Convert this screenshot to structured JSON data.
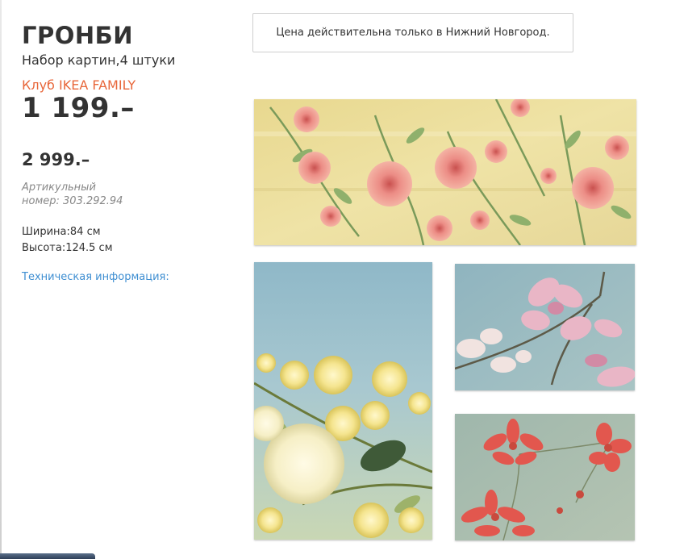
{
  "product": {
    "name": "ГРОНБИ",
    "description": "Набор картин,4 штуки",
    "family_label": "Клуб IKEA FAMILY",
    "family_price": "1 199.–",
    "regular_price": "2 999.–",
    "article_label": "Артикульный",
    "article_number": "номер: 303.292.94",
    "width": "Ширина:84 см",
    "height": "Высота:124.5 см",
    "tech_info_link": "Техническая информация:"
  },
  "notice": {
    "text": "Цена действительна только в Нижний Новгород."
  },
  "gallery": {
    "panels": [
      {
        "subject": "pink-blossoms-on-yellow"
      },
      {
        "subject": "yellow-roses-on-blue"
      },
      {
        "subject": "pink-magnolia-on-blue"
      },
      {
        "subject": "red-cosmos-on-grey-green"
      }
    ]
  },
  "colors": {
    "text": "#333333",
    "family_orange": "#e8673b",
    "link_blue": "#3f8fd2",
    "muted": "#888888"
  }
}
